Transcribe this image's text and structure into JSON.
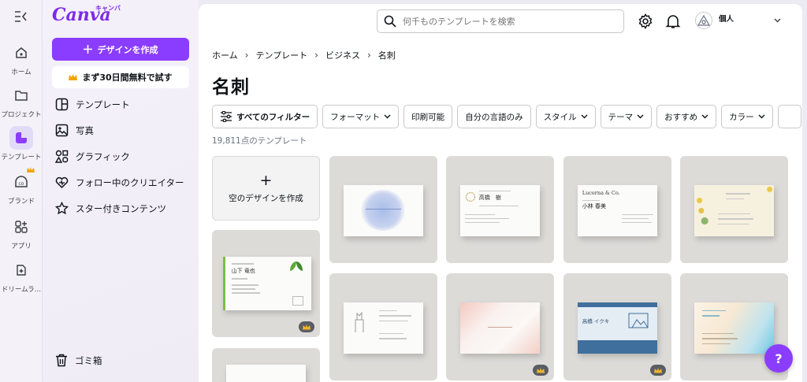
{
  "app": {
    "brand": "Canva",
    "brand_sub": "キャンバ",
    "accent": "#8b3dff"
  },
  "rail": [
    {
      "label": "ホーム",
      "icon": "home-icon"
    },
    {
      "label": "プロジェクト",
      "icon": "folder-icon"
    },
    {
      "label": "テンプレート",
      "icon": "template-icon",
      "active": true
    },
    {
      "label": "ブランド",
      "icon": "brand-icon"
    },
    {
      "label": "アプリ",
      "icon": "apps-icon"
    },
    {
      "label": "ドリームラ…",
      "icon": "dream-lab-icon"
    }
  ],
  "panel": {
    "create_label": "デザインを作成",
    "trial_label": "まず30日間無料で試す",
    "nav": [
      {
        "label": "テンプレート",
        "icon": "template-icon"
      },
      {
        "label": "写真",
        "icon": "photo-icon"
      },
      {
        "label": "グラフィック",
        "icon": "graphics-icon"
      },
      {
        "label": "フォロー中のクリエイター",
        "icon": "heart-icon"
      },
      {
        "label": "スター付きコンテンツ",
        "icon": "star-icon"
      }
    ],
    "trash_label": "ゴミ箱"
  },
  "header": {
    "search_placeholder": "何千ものテンプレートを検索",
    "account_name": "個人"
  },
  "breadcrumb": [
    "ホーム",
    "テンプレート",
    "ビジネス",
    "名刺"
  ],
  "page_title": "名刺",
  "filters": [
    {
      "label": "すべてのフィルター",
      "all": true
    },
    {
      "label": "フォーマット",
      "dropdown": true
    },
    {
      "label": "印刷可能",
      "dropdown": false
    },
    {
      "label": "自分の言語のみ",
      "dropdown": false
    },
    {
      "label": "スタイル",
      "dropdown": true
    },
    {
      "label": "テーマ",
      "dropdown": true
    },
    {
      "label": "おすすめ",
      "dropdown": true
    },
    {
      "label": "カラー",
      "dropdown": true
    }
  ],
  "result_count": "19,811点のテンプレート",
  "blank_tile": {
    "label": "空のデザインを作成"
  },
  "templates": [
    {
      "name": "business-card-blue-watercolor",
      "premium": false
    },
    {
      "name": "business-card-gold-emblem",
      "text": "高橋　樹",
      "premium": false
    },
    {
      "name": "business-card-lucerna",
      "text": "Lucerna & Co.",
      "name_text": "小林 春美",
      "premium": false
    },
    {
      "name": "business-card-mimosa",
      "premium": false
    },
    {
      "name": "business-card-green-leaf",
      "text": "山下 竜也",
      "premium": true
    },
    {
      "name": "business-card-line-drawing",
      "premium": false
    },
    {
      "name": "business-card-pink-watercolor",
      "premium": true
    },
    {
      "name": "business-card-blue-illustration",
      "text": "高橋 イクキ",
      "premium": true
    },
    {
      "name": "business-card-aqua-gradient",
      "premium": true
    }
  ],
  "help_label": "?"
}
